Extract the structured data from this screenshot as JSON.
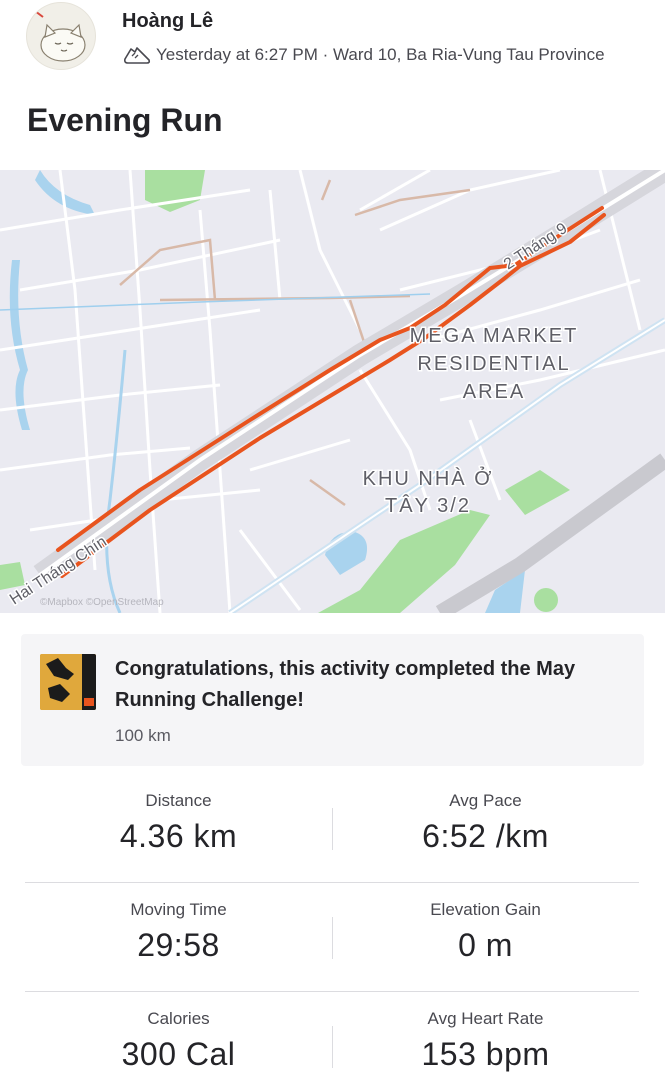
{
  "athlete": {
    "name": "Hoàng Lê",
    "meta": "Yesterday at 6:27 PM · Ward 10, Ba Ria-Vung Tau Province"
  },
  "activity": {
    "title": "Evening Run"
  },
  "map": {
    "labels": {
      "mega_market_1": "MEGA MARKET",
      "mega_market_2": "RESIDENTIAL",
      "mega_market_3": "AREA",
      "khu_nha_1": "KHU NHÀ Ở",
      "khu_nha_2": "TÂY 3/2",
      "road_top": "2 Tháng 9",
      "road_bottom": "Hai Tháng Chín",
      "attribution": "©Mapbox ©OpenStreetMap"
    },
    "colors": {
      "route": "#e8541e",
      "road": "#ffffff",
      "highway": "#c9c9cf",
      "park": "#a9dfa0",
      "water": "#a9d3ee"
    }
  },
  "challenge": {
    "text": "Congratulations, this activity completed the May Running Challenge!",
    "sub": "100 km"
  },
  "stats": {
    "distance_label": "Distance",
    "distance_value": "4.36 km",
    "pace_label": "Avg Pace",
    "pace_value": "6:52 /km",
    "moving_time_label": "Moving Time",
    "moving_time_value": "29:58",
    "elevation_label": "Elevation Gain",
    "elevation_value": "0 m",
    "calories_label": "Calories",
    "calories_value": "300 Cal",
    "heart_rate_label": "Avg Heart Rate",
    "heart_rate_value": "153 bpm"
  }
}
